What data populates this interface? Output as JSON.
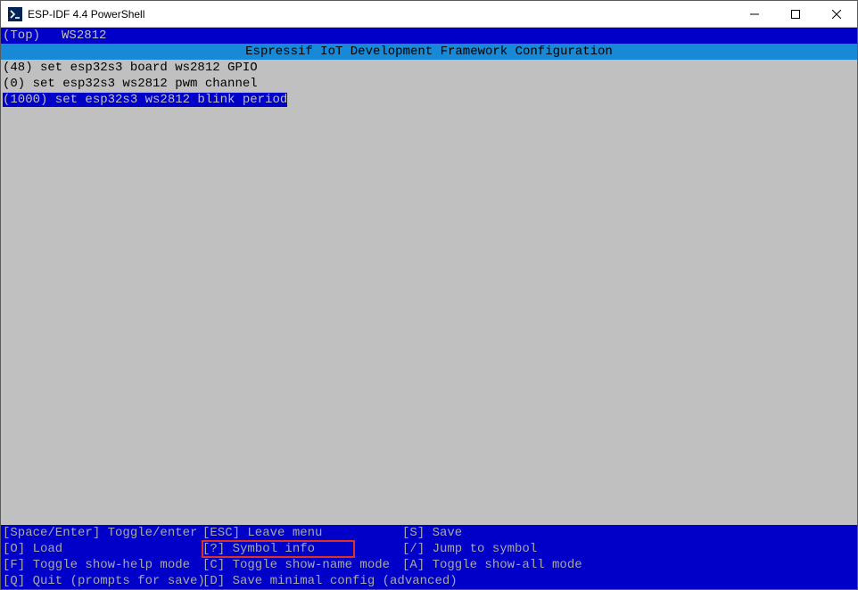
{
  "window": {
    "title": "ESP-IDF 4.4 PowerShell"
  },
  "topbar": {
    "top_label": "(Top)",
    "breadcrumb": "WS2812"
  },
  "header": "Espressif IoT Development Framework Configuration",
  "config_items": [
    {
      "value": "48",
      "label": "set esp32s3 board ws2812 GPIO",
      "selected": false
    },
    {
      "value": "0",
      "label": "set esp32s3 ws2812 pwm channel",
      "selected": false
    },
    {
      "value": "1000",
      "label": "set esp32s3 ws2812 blink period",
      "selected": true
    }
  ],
  "help": {
    "rows": [
      [
        {
          "key": "[Space/Enter]",
          "text": "Toggle/enter"
        },
        {
          "key": "[ESC]",
          "text": "Leave menu"
        },
        {
          "key": "[S]",
          "text": "Save"
        }
      ],
      [
        {
          "key": "[O]",
          "text": "Load"
        },
        {
          "key": "[?]",
          "text": "Symbol info",
          "highlight": true
        },
        {
          "key": "[/]",
          "text": "Jump to symbol"
        }
      ],
      [
        {
          "key": "[F]",
          "text": "Toggle show-help mode"
        },
        {
          "key": "[C]",
          "text": "Toggle show-name mode"
        },
        {
          "key": "[A]",
          "text": "Toggle show-all mode"
        }
      ],
      [
        {
          "key": "[Q]",
          "text": "Quit (prompts for save)"
        },
        {
          "key": "[D]",
          "text": "Save minimal config (advanced)"
        }
      ]
    ]
  }
}
